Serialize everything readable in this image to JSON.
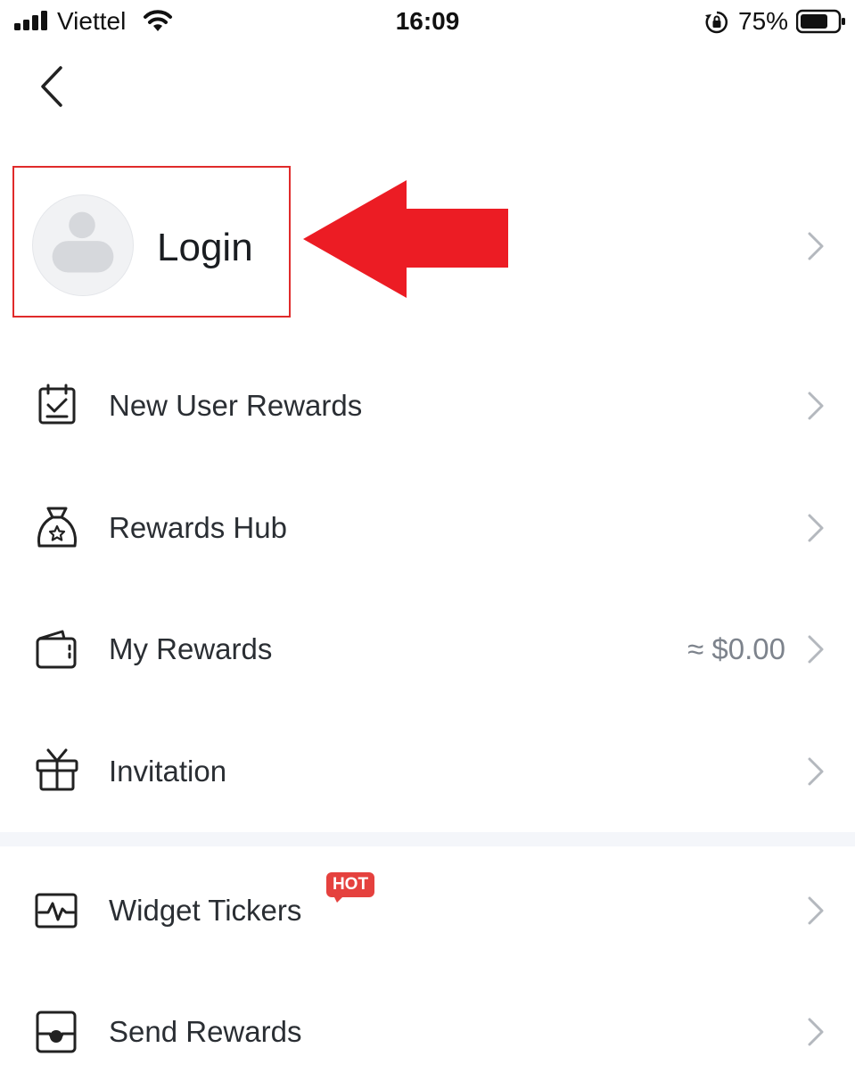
{
  "status_bar": {
    "carrier": "Viettel",
    "time": "16:09",
    "battery_percent": "75%",
    "battery_level": 0.75
  },
  "header": {
    "back_icon": "chevron-left-icon"
  },
  "login": {
    "label": "Login",
    "avatar_icon": "user-placeholder-icon",
    "annotation_color": "#e02b2b"
  },
  "menu": {
    "items": [
      {
        "label": "New User Rewards",
        "icon": "calendar-check-icon",
        "value": ""
      },
      {
        "label": "Rewards Hub",
        "icon": "money-bag-star-icon",
        "value": ""
      },
      {
        "label": "My Rewards",
        "icon": "wallet-icon",
        "value": "≈ $0.00"
      },
      {
        "label": "Invitation",
        "icon": "gift-icon",
        "value": ""
      },
      {
        "label": "Widget Tickers",
        "icon": "pulse-chart-icon",
        "value": "",
        "badge": "HOT"
      },
      {
        "label": "Send Rewards",
        "icon": "envelope-icon",
        "value": ""
      }
    ]
  },
  "colors": {
    "accent_red": "#e5413e",
    "chevron": "#b4b8be",
    "divider": "#f4f6fa"
  }
}
